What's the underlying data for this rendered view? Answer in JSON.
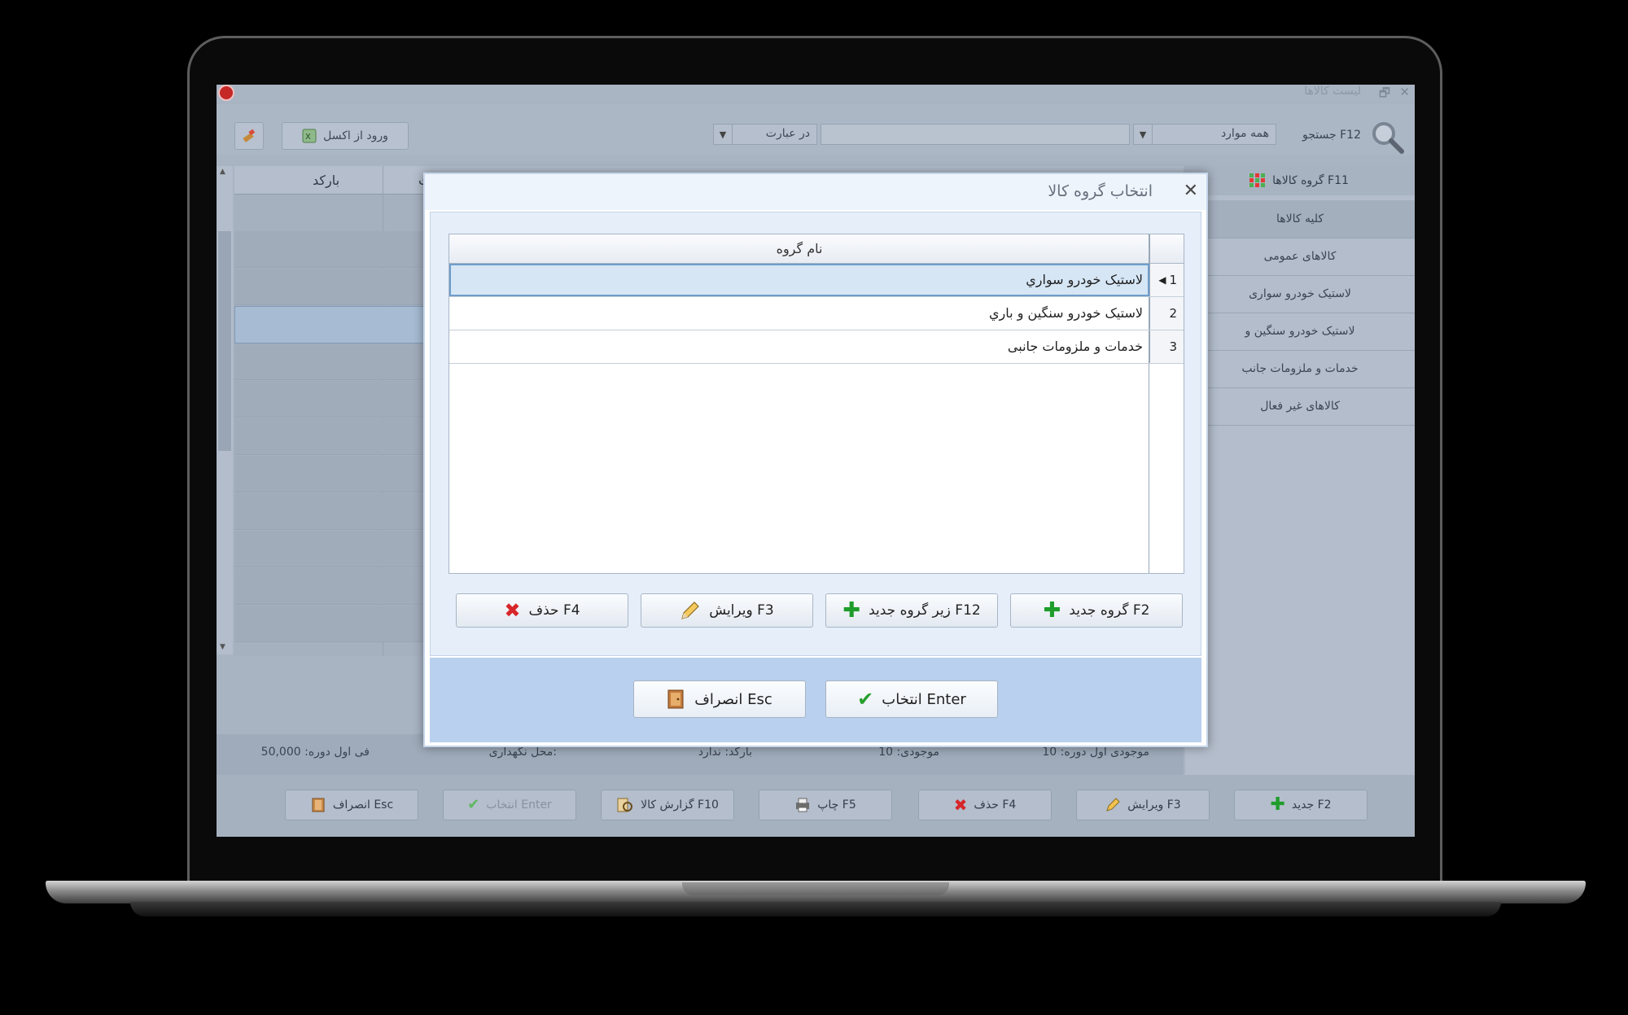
{
  "window": {
    "title": "لیست کالاها",
    "minimize": "–",
    "maximize": "🗗",
    "close": "✕"
  },
  "toolbar": {
    "excel_label": "ورود از اکسل",
    "search_label": "جستجو F12",
    "scope_value": "همه موارد",
    "match_value": "در عبارت",
    "search_value": ""
  },
  "grid": {
    "barcode_header": "بارکد",
    "partial_header": "ت"
  },
  "side_panel": {
    "header": "گروه کالاها F11",
    "items": [
      "کلیه کالاها",
      "کالاهای عمومی",
      "لاستیک خودرو سواری",
      "لاستیک خودرو سنگین و",
      "خدمات و ملزومات جانب",
      "کالاهای غیر فعال"
    ]
  },
  "status": {
    "opening_stock": "موجودی اول دوره: 10",
    "stock": "موجودی: 10",
    "barcode": "بارکد: ندارد",
    "storage_location": "محل نگهداری:",
    "opening_price": "فی اول دوره: 50,000"
  },
  "bottom_buttons": {
    "new": "جدید F2",
    "edit": "ویرایش F3",
    "delete": "حذف F4",
    "print": "چاپ F5",
    "report": "گزارش کالا F10",
    "select": "انتخاب Enter",
    "cancel": "انصراف Esc"
  },
  "dialog": {
    "title": "انتخاب گروه کالا",
    "close": "✕",
    "column_header": "نام گروه",
    "rows": [
      {
        "num": "1",
        "name": "لاستیک خودرو سواري"
      },
      {
        "num": "2",
        "name": "لاستیک خودرو سنگین و باري"
      },
      {
        "num": "3",
        "name": "خدمات و ملزومات جانبی"
      }
    ],
    "buttons": {
      "new_group": "گروه جدید F2",
      "new_subgroup": "زیر گروه جدید F12",
      "edit": "ویرایش F3",
      "delete": "حذف F4"
    },
    "footer": {
      "select": "انتخاب Enter",
      "cancel": "انصراف Esc"
    }
  },
  "colors": {
    "accent_green": "#1f9d2b",
    "accent_red": "#d7262a",
    "selection_border": "#6f9dc9",
    "dialog_footer": "#b9d0ee"
  }
}
